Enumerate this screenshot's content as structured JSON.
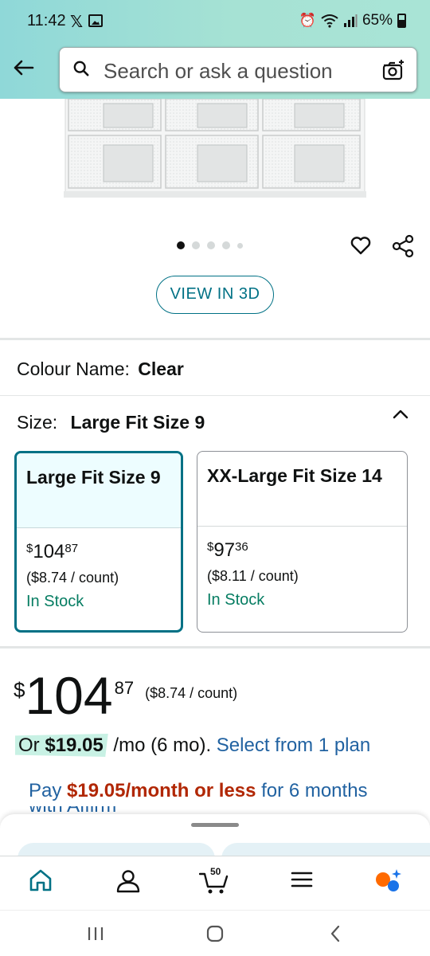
{
  "status_bar": {
    "time": "11:42",
    "battery": "65%"
  },
  "search": {
    "placeholder": "Search or ask a question"
  },
  "gallery": {
    "image_count": 5,
    "active_index": 0
  },
  "view3d_label": "VIEW IN 3D",
  "colour": {
    "label": "Colour Name:",
    "value": "Clear"
  },
  "size": {
    "label": "Size:",
    "value": "Large Fit Size 9",
    "options": [
      {
        "name": "Large Fit Size 9",
        "price_symbol": "$",
        "price_whole": "104",
        "price_cents": "87",
        "unit_price": "($8.74 / count)",
        "stock": "In Stock"
      },
      {
        "name": "XX-Large Fit Size 14",
        "price_symbol": "$",
        "price_whole": "97",
        "price_cents": "36",
        "unit_price": "($8.11 / count)",
        "stock": "In Stock"
      }
    ]
  },
  "price": {
    "symbol": "$",
    "whole": "104",
    "cents": "87",
    "unit": "($8.74 / count)"
  },
  "monthly": {
    "prefix": "Or",
    "amount": "$19.05",
    "suffix": "/mo (6 mo).",
    "link": "Select from 1 plan"
  },
  "affirm": {
    "prefix": "Pay",
    "amount": "$19.05/month or less",
    "suffix": "for 6 months",
    "next_line": "with Affirm"
  },
  "bottom_nav": {
    "cart_count": "50"
  },
  "colors": {
    "accent": "#007185",
    "in_stock": "#067d62",
    "price_red": "#b12704",
    "link_blue": "#2162a1",
    "header_teal": "#8fd8d8"
  }
}
